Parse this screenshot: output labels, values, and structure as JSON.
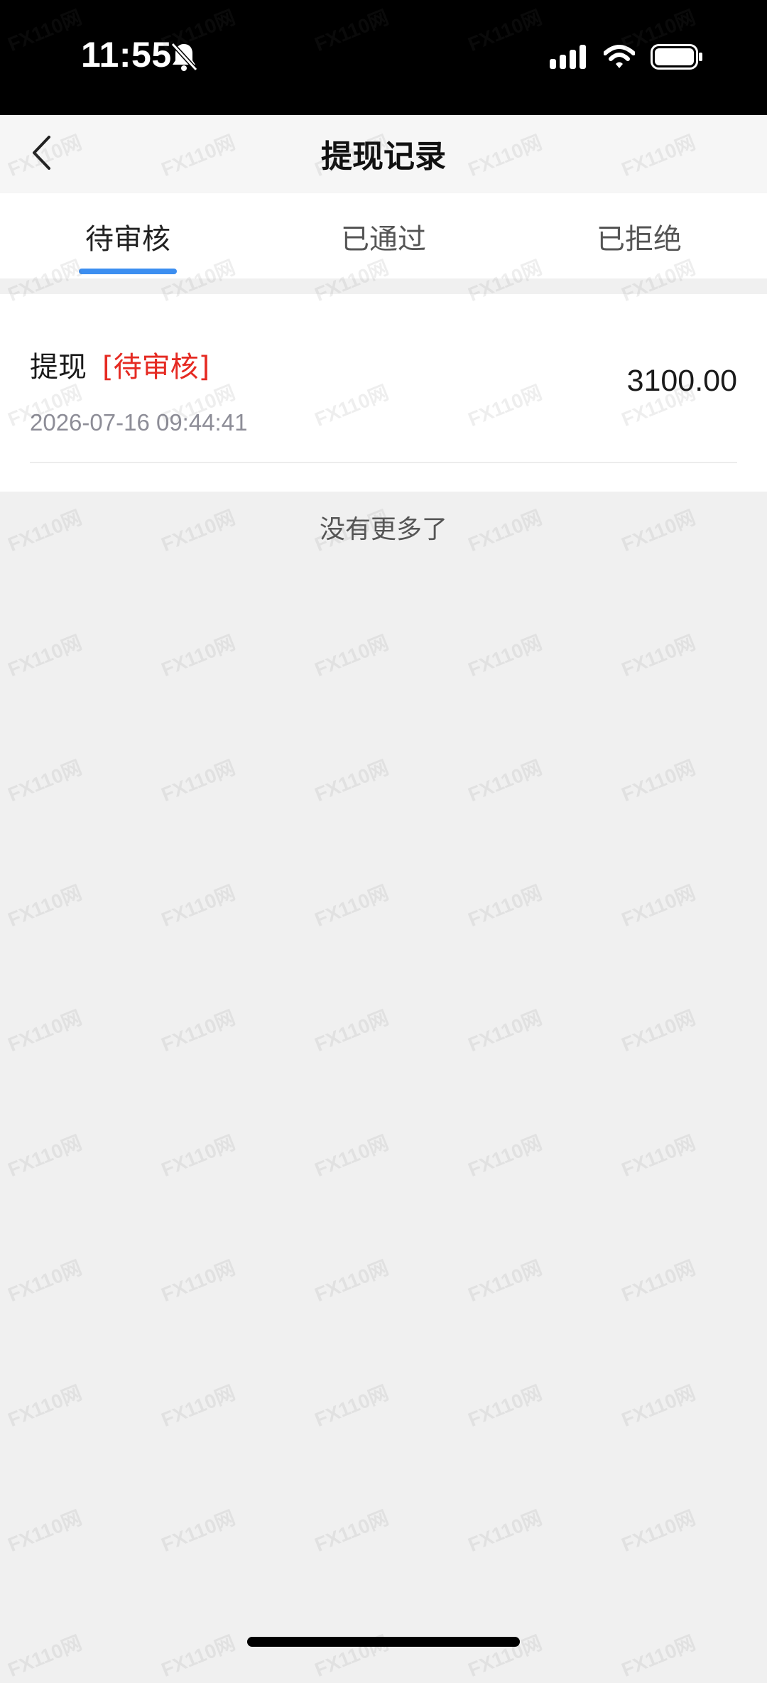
{
  "status_bar": {
    "time": "11:55",
    "icons": [
      "bell-slash-icon",
      "cellular-signal-icon",
      "wifi-icon",
      "battery-icon"
    ]
  },
  "header": {
    "title": "提现记录",
    "back_icon": "chevron-left-icon"
  },
  "tabs": [
    {
      "label": "待审核",
      "active": true
    },
    {
      "label": "已通过",
      "active": false
    },
    {
      "label": "已拒绝",
      "active": false
    }
  ],
  "records": [
    {
      "type": "提现",
      "status": "[待审核]",
      "time": "2026-07-16 09:44:41",
      "amount": "3100.00"
    }
  ],
  "list_end_text": "没有更多了",
  "watermark": "FX110网",
  "colors": {
    "accent": "#3c8ef0",
    "status_pending": "#e52a22",
    "page_background": "#f0f0f0"
  }
}
